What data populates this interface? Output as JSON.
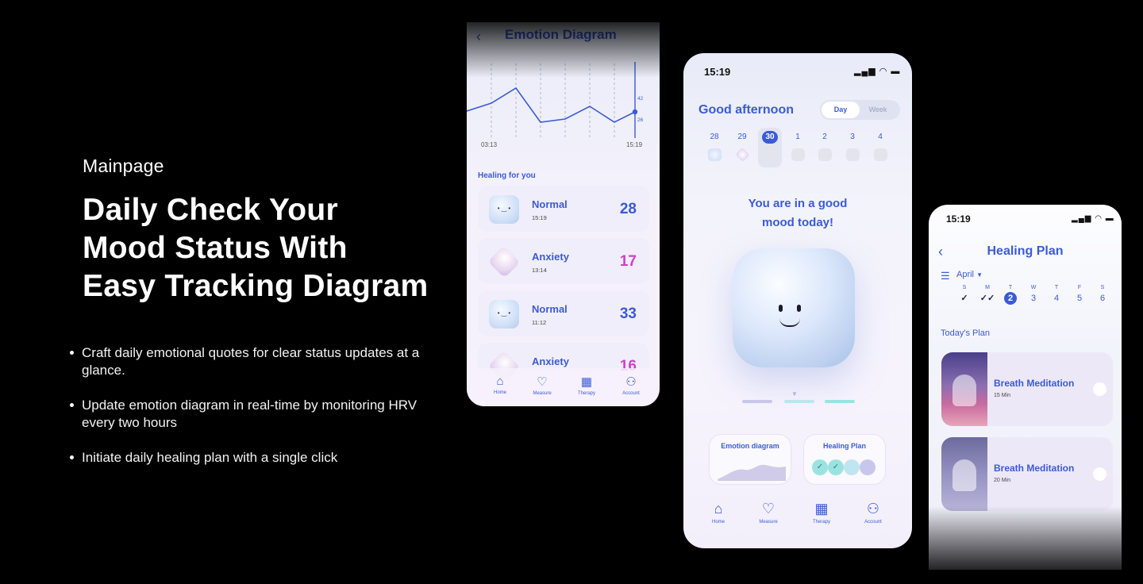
{
  "intro": {
    "eyebrow": "Mainpage",
    "headline_lines": [
      "Daily Check Your",
      "Mood Status With",
      "Easy Tracking Diagram"
    ],
    "bullets": [
      "Craft daily emotional quotes for clear status updates at a glance.",
      "Update emotion diagram in real-time by monitoring HRV every two hours",
      "Initiate daily healing plan with a single click"
    ]
  },
  "diagram_screen": {
    "title": "Emotion Diagram",
    "chart": {
      "y_labels": [
        "42",
        "26"
      ],
      "x_start": "03:13",
      "x_end": "15:19"
    },
    "section_title": "Healing for you",
    "entries": [
      {
        "mood": "Normal",
        "time": "15:19",
        "value": "28"
      },
      {
        "mood": "Anxiety",
        "time": "13:14",
        "value": "17"
      },
      {
        "mood": "Normal",
        "time": "11:12",
        "value": "33"
      },
      {
        "mood": "Anxiety",
        "time": "",
        "value": "16"
      }
    ],
    "nav": [
      "Home",
      "Measure",
      "Therapy",
      "Account"
    ]
  },
  "main_screen": {
    "status_time": "15:19",
    "greeting": "Good afternoon",
    "toggle": {
      "day": "Day",
      "week": "Week"
    },
    "dates": [
      "28",
      "29",
      "30",
      "1",
      "2",
      "3",
      "4"
    ],
    "selected_date": "30",
    "mood_line1": "You are in a good",
    "mood_line2": "mood today!",
    "tiles": {
      "diagram": "Emotion diagram",
      "plan": "Healing Plan"
    },
    "nav": [
      "Home",
      "Measure",
      "Therapy",
      "Account"
    ]
  },
  "plan_screen": {
    "status_time": "15:19",
    "title": "Healing Plan",
    "month": "April",
    "week": [
      {
        "l": "S",
        "n": "✓"
      },
      {
        "l": "M",
        "n": "✓✓"
      },
      {
        "l": "T",
        "n": "2"
      },
      {
        "l": "W",
        "n": "3"
      },
      {
        "l": "T",
        "n": "4"
      },
      {
        "l": "F",
        "n": "5"
      },
      {
        "l": "S",
        "n": "6"
      }
    ],
    "today_title": "Today's Plan",
    "plans": [
      {
        "name": "Breath Meditation",
        "duration": "15 Min"
      },
      {
        "name": "Breath Meditation",
        "duration": "20 Min"
      }
    ]
  },
  "colors": {
    "accent": "#3b5bd6",
    "anxiety": "#cf3fd0",
    "teal": "#9be3e0",
    "lavender": "#c9c6ec"
  }
}
